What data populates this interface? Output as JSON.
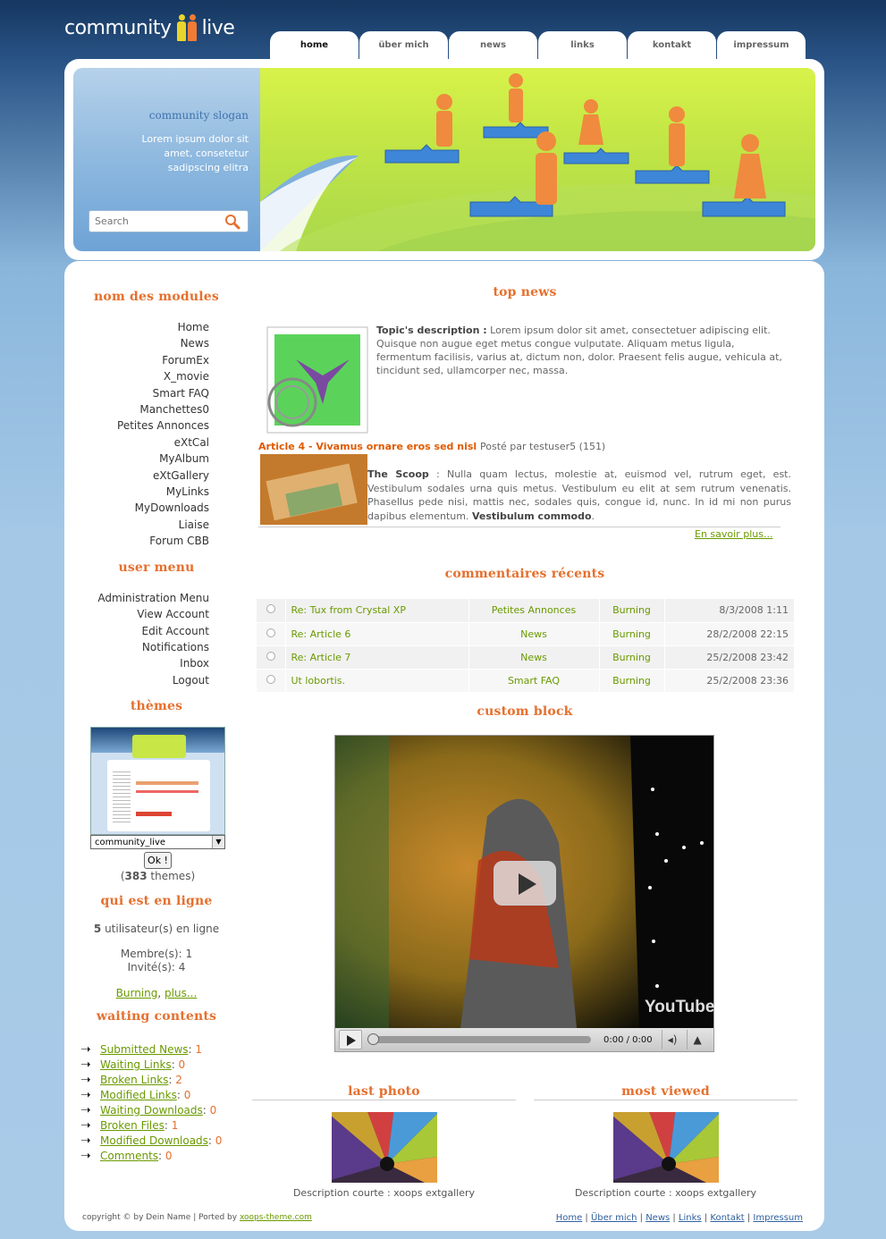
{
  "header": {
    "logo_word1": "community",
    "logo_word2": "live",
    "tabs": [
      "home",
      "über mich",
      "news",
      "links",
      "kontakt",
      "impressum"
    ],
    "active_tab": "home"
  },
  "banner": {
    "slogan": "community slogan",
    "lorem": "Lorem ipsum dolor sit amet, consetetur sadipscing elitra",
    "search_placeholder": "Search"
  },
  "sidebar": {
    "modules_title": "nom des modules",
    "modules": [
      "Home",
      "News",
      "ForumEx",
      "X_movie",
      "Smart FAQ",
      "Manchettes0",
      "Petites Annonces",
      "eXtCal",
      "MyAlbum",
      "eXtGallery",
      "MyLinks",
      "MyDownloads",
      "Liaise",
      "Forum CBB"
    ],
    "user_menu_title": "user menu",
    "user_menu": [
      "Administration Menu",
      "View Account",
      "Edit Account",
      "Notifications",
      "Inbox",
      "Logout"
    ],
    "themes_title": "thèmes",
    "theme_selected": "community_live",
    "ok_label": "Ok !",
    "themes_count": "383",
    "themes_suffix": "themes",
    "online_title": "qui est en ligne",
    "online_count": "5",
    "online_text": "utilisateur(s) en ligne",
    "members_text": "Membre(s): 1",
    "guests_text": "Invité(s): 4",
    "online_user": "Burning",
    "online_more": "plus...",
    "waiting_title": "waiting contents",
    "waiting": [
      {
        "label": "Submitted News",
        "count": "1"
      },
      {
        "label": "Waiting Links",
        "count": "0"
      },
      {
        "label": "Broken Links",
        "count": "2"
      },
      {
        "label": "Modified Links",
        "count": "0"
      },
      {
        "label": "Waiting Downloads",
        "count": "0"
      },
      {
        "label": "Broken Files",
        "count": "1"
      },
      {
        "label": "Modified Downloads",
        "count": "0"
      },
      {
        "label": "Comments",
        "count": "0"
      }
    ]
  },
  "content": {
    "top_news_title": "top news",
    "topic_label": "Topic's description :",
    "topic_text": "Lorem ipsum dolor sit amet, consectetuer adipiscing elit. Quisque non augue eget metus congue vulputate. Aliquam metus ligula, fermentum facilisis, varius at, dictum non, dolor. Praesent felis augue, vehicula at, tincidunt sed, ullamcorper nec, massa.",
    "article_title": "Article 4 - Vivamus ornare eros sed nisl",
    "article_meta": "Posté par testuser5 (151)",
    "scoop_label": "The Scoop",
    "scoop_text": ": Nulla quam lectus, molestie at, euismod vel, rutrum eget, est. Vestibulum sodales urna quis metus. Vestibulum eu elit at sem rutrum venenatis. Phasellus pede nisi, mattis nec, sodales quis, congue id, nunc. In id mi non purus dapibus elementum.",
    "scoop_bold_end": "Vestibulum commodo",
    "read_more": "En savoir plus...",
    "comments_title": "commentaires récents",
    "comments": [
      {
        "title": "Re: Tux from Crystal XP",
        "module": "Petites Annonces",
        "user": "Burning",
        "date": "8/3/2008 1:11"
      },
      {
        "title": "Re: Article 6",
        "module": "News",
        "user": "Burning",
        "date": "28/2/2008 22:15"
      },
      {
        "title": "Re: Article 7",
        "module": "News",
        "user": "Burning",
        "date": "25/2/2008 23:42"
      },
      {
        "title": "Ut lobortis.",
        "module": "Smart FAQ",
        "user": "Burning",
        "date": "25/2/2008 23:36"
      }
    ],
    "custom_block_title": "custom block",
    "video_time": "0:00 / 0:00",
    "video_brand": "YouTube",
    "last_photo_title": "last photo",
    "most_viewed_title": "most viewed",
    "photo_caption": "Description courte : xoops extgallery"
  },
  "footer": {
    "copyright": "copyright © by Dein Name | Ported by",
    "ported_link": "xoops-theme.com",
    "links": [
      "Home",
      "Über mich",
      "News",
      "Links",
      "Kontakt",
      "Impressum"
    ]
  },
  "colors": {
    "accent_orange": "#e5702e",
    "link_green": "#6a9a00",
    "footer_link_blue": "#3060a0"
  }
}
